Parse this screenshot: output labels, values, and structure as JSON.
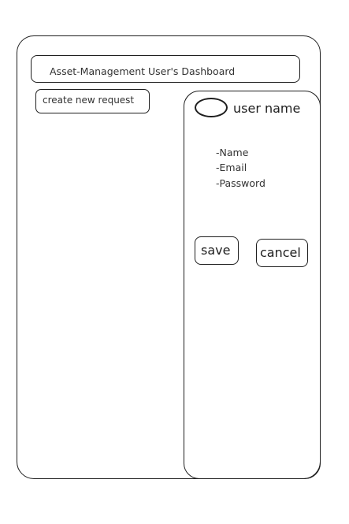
{
  "header": {
    "title": "Asset-Management User's Dashboard"
  },
  "actions": {
    "create_label": "create new request"
  },
  "profile": {
    "username": "user name",
    "fields": [
      "-Name",
      "-Email",
      "-Password"
    ],
    "save_label": "save",
    "cancel_label": "cancel"
  }
}
